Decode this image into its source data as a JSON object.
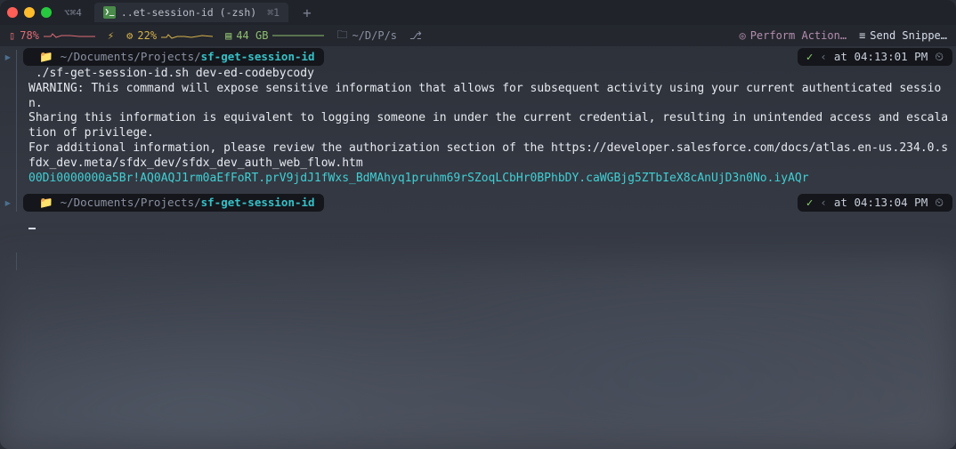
{
  "titlebar": {
    "hint_icon": "⌥⌘4",
    "tab_icon": "❯_",
    "tab_title": "..et-session-id (-zsh)",
    "tab_shortcut": "⌘1",
    "add_tab": "+"
  },
  "statusbar": {
    "battery_icon": "🔋",
    "battery_pct": "78%",
    "bolt_icon": "⚡",
    "cpu_icon": "⚙",
    "cpu_pct": "22%",
    "ram_icon": "▤",
    "ram_text": "44 GB",
    "folder_icon": "🗀",
    "path": "~/D/P/s",
    "branch_icon": "⎇",
    "action_icon": "◎",
    "action_text": "Perform Action…",
    "snippet_icon": "≡",
    "snippet_text": "Send Snippe…"
  },
  "prompt1": {
    "apple": "",
    "folder": "📁",
    "path_prefix": "~/Documents/Projects/",
    "path_leaf": "sf-get-session-id",
    "check": "✓",
    "caret": "‹",
    "time_prefix": "at",
    "time": "04:13:01 PM",
    "clock": "⏲"
  },
  "output": {
    "cmd": "./sf-get-session-id.sh dev-ed-codebycody",
    "warn1": "WARNING: This command will expose sensitive information that allows for subsequent activity using your current authenticated session.",
    "warn2": "Sharing this information is equivalent to logging someone in under the current credential, resulting in unintended access and escalation of privilege.",
    "warn3": "For additional information, please review the authorization section of the https://developer.salesforce.com/docs/atlas.en-us.234.0.sfdx_dev.meta/sfdx_dev/sfdx_dev_auth_web_flow.htm",
    "blank": "",
    "token": "00Di0000000a5Br!AQ0AQJ1rm0aEfFoRT.prV9jdJ1fWxs_BdMAhyq1pruhm69rSZoqLCbHr0BPhbDY.caWGBjg5ZTbIeX8cAnUjD3n0No.iyAQr"
  },
  "prompt2": {
    "apple": "",
    "folder": "📁",
    "path_prefix": "~/Documents/Projects/",
    "path_leaf": "sf-get-session-id",
    "check": "✓",
    "caret": "‹",
    "time_prefix": "at",
    "time": "04:13:04 PM",
    "clock": "⏲"
  }
}
